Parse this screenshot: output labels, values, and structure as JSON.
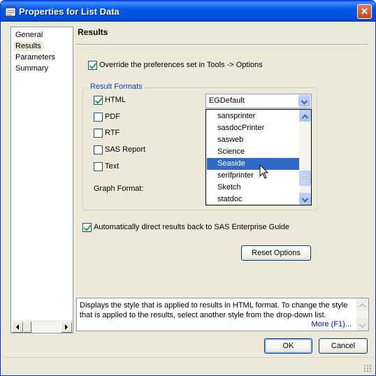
{
  "window": {
    "title": "Properties for List Data",
    "close_symbol": "✕"
  },
  "nav": {
    "items": [
      {
        "label": "General",
        "selected": false
      },
      {
        "label": "Results",
        "selected": true
      },
      {
        "label": "Parameters",
        "selected": false
      },
      {
        "label": "Summary",
        "selected": false
      }
    ]
  },
  "page": {
    "title": "Results",
    "override_label": "Override the preferences set in Tools -> Options",
    "override_checked": true
  },
  "result_formats": {
    "legend": "Result Formats",
    "formats": [
      {
        "label": "HTML",
        "checked": true
      },
      {
        "label": "PDF",
        "checked": false
      },
      {
        "label": "RTF",
        "checked": false
      },
      {
        "label": "SAS Report",
        "checked": false
      },
      {
        "label": "Text",
        "checked": false
      }
    ],
    "graph_format_label": "Graph Format:"
  },
  "style_combo": {
    "value": "EGDefault",
    "options": [
      "sansprinter",
      "sasdocPrinter",
      "sasweb",
      "Science",
      "Seaside",
      "serifprinter",
      "Sketch",
      "statdoc"
    ],
    "highlighted": "Seaside"
  },
  "auto_direct": {
    "label": "Automatically direct results back to SAS Enterprise Guide",
    "checked": true
  },
  "buttons": {
    "reset": "Reset Options",
    "ok": "OK",
    "cancel": "Cancel"
  },
  "help": {
    "text": "Displays the style that is applied to results in HTML format. To change the style that is applied to the results, select another style from the drop-down list.",
    "more_link": "More (F1)..."
  },
  "colors": {
    "titlebar": "#0054e3",
    "selection": "#316ac5",
    "link": "#0000ff",
    "group_legend": "#0046d5"
  }
}
